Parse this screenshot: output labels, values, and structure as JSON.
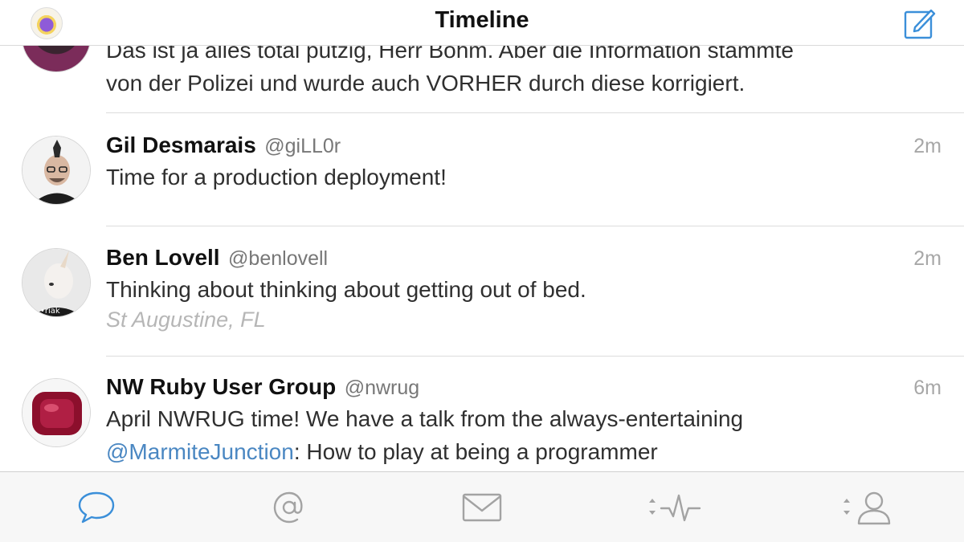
{
  "header": {
    "title": "Timeline",
    "compose_icon": "compose-icon",
    "accent": "#3b8fd9"
  },
  "tweets": [
    {
      "text_line1": "Das ist ja alles total putzig, Herr Bohm. Aber die Information stammte",
      "text_line2": "von der Polizei und wurde auch VORHER durch diese korrigiert."
    },
    {
      "name": "Gil Desmarais",
      "handle": "@giLL0r",
      "time": "2m",
      "text": "Time for a production deployment!"
    },
    {
      "name": "Ben Lovell",
      "handle": "@benlovell",
      "time": "2m",
      "text": "Thinking about thinking about getting out of bed.",
      "location": "St Augustine, FL"
    },
    {
      "name": "NW Ruby User Group",
      "handle": "@nwrug",
      "time": "6m",
      "text_line1": "April NWRUG time! We have a talk from the always-entertaining",
      "mention": "@MarmiteJunction",
      "text_line2_rest": ": How to play at being a programmer"
    }
  ],
  "tabbar": {
    "active_color": "#3b8fd9",
    "inactive_color": "#a3a3a3",
    "tabs": [
      {
        "icon": "chat-bubble-icon"
      },
      {
        "icon": "at-sign-icon"
      },
      {
        "icon": "envelope-icon"
      },
      {
        "icon": "activity-icon"
      },
      {
        "icon": "profile-icon"
      }
    ]
  }
}
